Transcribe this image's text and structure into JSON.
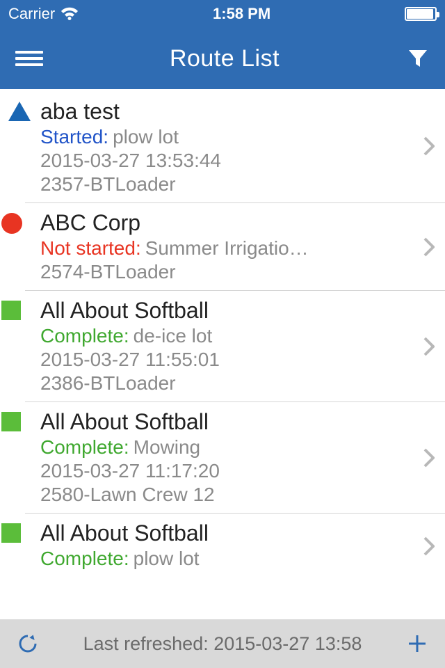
{
  "status": {
    "carrier": "Carrier",
    "time": "1:58 PM"
  },
  "nav": {
    "title": "Route List"
  },
  "rows": [
    {
      "shape": "triangle",
      "title": "aba test",
      "status_label": "Started:",
      "status_class": "status-started",
      "task": "plow lot",
      "time": "2015-03-27 13:53:44",
      "code": "2357-BTLoader"
    },
    {
      "shape": "circle",
      "title": "ABC Corp",
      "status_label": "Not started:",
      "status_class": "status-notstarted",
      "task": "Summer Irrigatio…",
      "time": "",
      "code": "2574-BTLoader"
    },
    {
      "shape": "square",
      "title": "All About Softball",
      "status_label": "Complete:",
      "status_class": "status-complete",
      "task": "de-ice lot",
      "time": "2015-03-27 11:55:01",
      "code": "2386-BTLoader"
    },
    {
      "shape": "square",
      "title": "All About Softball",
      "status_label": "Complete:",
      "status_class": "status-complete",
      "task": "Mowing",
      "time": "2015-03-27 11:17:20",
      "code": "2580-Lawn Crew 12"
    },
    {
      "shape": "square",
      "title": "All About Softball",
      "status_label": "Complete:",
      "status_class": "status-complete",
      "task": "plow lot",
      "time": "",
      "code": ""
    }
  ],
  "footer": {
    "text": "Last refreshed: 2015-03-27 13:58"
  }
}
